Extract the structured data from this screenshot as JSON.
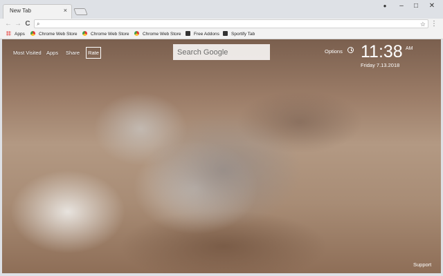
{
  "tab": {
    "title": "New Tab",
    "close": "×"
  },
  "window_controls": {
    "profile": "●",
    "minimize": "–",
    "maximize": "□",
    "close": "✕"
  },
  "toolbar": {
    "back": "←",
    "forward": "→",
    "reload": "C",
    "search_icon": "⌕",
    "star": "☆",
    "menu": "⋮",
    "omnibox_value": ""
  },
  "bookmarks": [
    {
      "label": "Apps",
      "icon": "apps-grid-icon"
    },
    {
      "label": "Chrome Web Store",
      "icon": "chrome-web-store-icon"
    },
    {
      "label": "Chrome Web Store",
      "icon": "chrome-web-store-icon"
    },
    {
      "label": "Chrome Web Store",
      "icon": "chrome-web-store-icon"
    },
    {
      "label": "Free Addons",
      "icon": "box-icon"
    },
    {
      "label": "Sportify Tab",
      "icon": "box-icon"
    }
  ],
  "page": {
    "nav": {
      "most_visited": "Most Visited",
      "apps": "Apps",
      "share": "Share",
      "rate": "Rate"
    },
    "search": {
      "placeholder": "Search Google"
    },
    "options": "Options",
    "clock": {
      "time": "11:38",
      "ampm": "AM",
      "date": "Friday  7.13.2018"
    },
    "support": "Support"
  }
}
